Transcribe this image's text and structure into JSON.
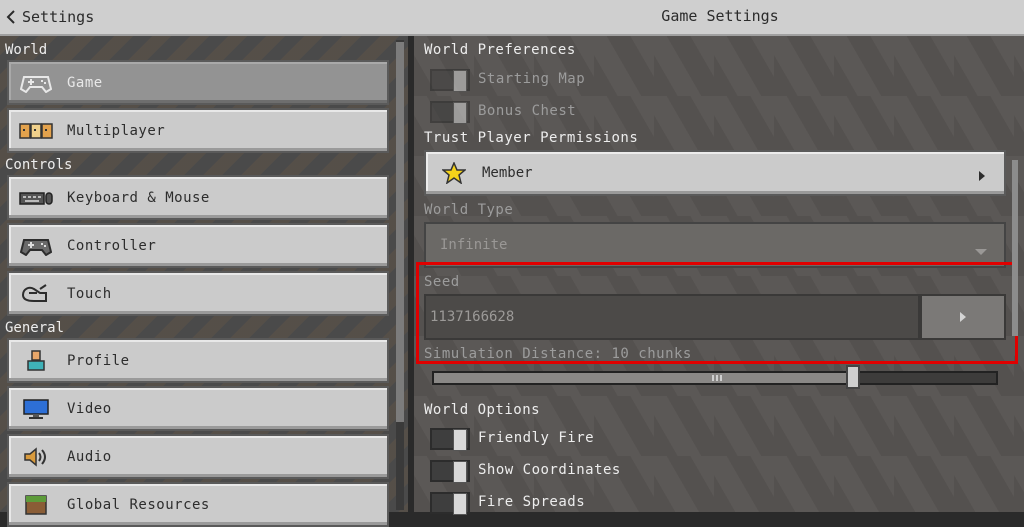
{
  "header": {
    "back_label": "Settings",
    "title": "Game Settings"
  },
  "sidebar": {
    "sections": [
      {
        "label": "World"
      },
      {
        "label": "Controls"
      },
      {
        "label": "General"
      }
    ],
    "items": [
      {
        "label": "Game",
        "icon": "controller-icon"
      },
      {
        "label": "Multiplayer",
        "icon": "multiplayer-icon"
      },
      {
        "label": "Keyboard & Mouse",
        "icon": "keyboard-icon"
      },
      {
        "label": "Controller",
        "icon": "controller-icon"
      },
      {
        "label": "Touch",
        "icon": "touch-icon"
      },
      {
        "label": "Profile",
        "icon": "profile-icon"
      },
      {
        "label": "Video",
        "icon": "monitor-icon"
      },
      {
        "label": "Audio",
        "icon": "speaker-icon"
      },
      {
        "label": "Global Resources",
        "icon": "grass-block-icon"
      }
    ]
  },
  "world_preferences": {
    "heading": "World Preferences",
    "toggles": [
      {
        "label": "Starting Map",
        "on": true
      },
      {
        "label": "Bonus Chest",
        "on": true
      }
    ]
  },
  "trust_permissions": {
    "heading": "Trust Player Permissions",
    "value": "Member",
    "icon": "star-icon"
  },
  "world_type": {
    "heading": "World Type",
    "value": "Infinite"
  },
  "seed": {
    "label": "Seed",
    "value": "1137166628"
  },
  "simulation_distance": {
    "label": "Simulation Distance: 10 chunks",
    "value": 10
  },
  "world_options": {
    "heading": "World Options",
    "toggles": [
      {
        "label": "Friendly Fire",
        "on": true
      },
      {
        "label": "Show Coordinates",
        "on": true
      },
      {
        "label": "Fire Spreads",
        "on": true
      }
    ]
  },
  "colors": {
    "highlight": "#e00000",
    "button": "#cbcbcb",
    "selected": "#939393"
  }
}
